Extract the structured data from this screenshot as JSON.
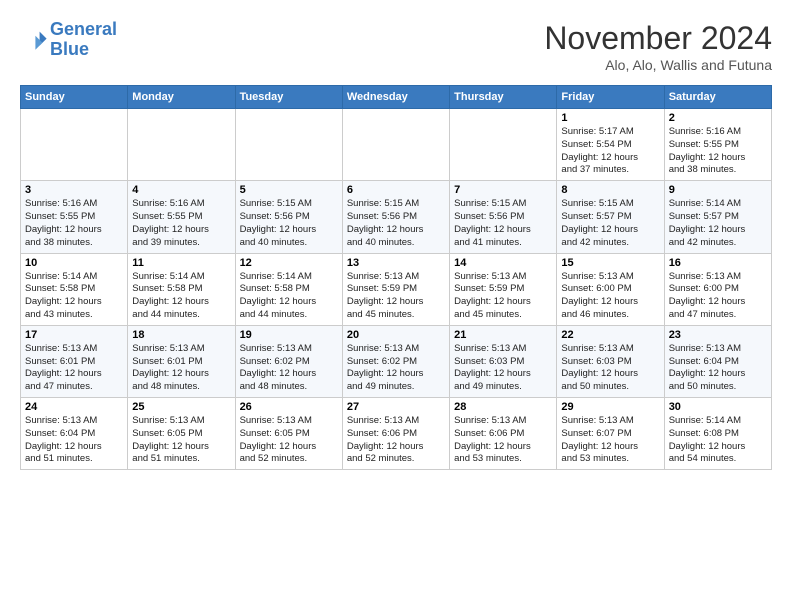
{
  "header": {
    "logo_line1": "General",
    "logo_line2": "Blue",
    "month": "November 2024",
    "location": "Alo, Alo, Wallis and Futuna"
  },
  "weekdays": [
    "Sunday",
    "Monday",
    "Tuesday",
    "Wednesday",
    "Thursday",
    "Friday",
    "Saturday"
  ],
  "weeks": [
    [
      {
        "day": "",
        "info": ""
      },
      {
        "day": "",
        "info": ""
      },
      {
        "day": "",
        "info": ""
      },
      {
        "day": "",
        "info": ""
      },
      {
        "day": "",
        "info": ""
      },
      {
        "day": "1",
        "info": "Sunrise: 5:17 AM\nSunset: 5:54 PM\nDaylight: 12 hours\nand 37 minutes."
      },
      {
        "day": "2",
        "info": "Sunrise: 5:16 AM\nSunset: 5:55 PM\nDaylight: 12 hours\nand 38 minutes."
      }
    ],
    [
      {
        "day": "3",
        "info": "Sunrise: 5:16 AM\nSunset: 5:55 PM\nDaylight: 12 hours\nand 38 minutes."
      },
      {
        "day": "4",
        "info": "Sunrise: 5:16 AM\nSunset: 5:55 PM\nDaylight: 12 hours\nand 39 minutes."
      },
      {
        "day": "5",
        "info": "Sunrise: 5:15 AM\nSunset: 5:56 PM\nDaylight: 12 hours\nand 40 minutes."
      },
      {
        "day": "6",
        "info": "Sunrise: 5:15 AM\nSunset: 5:56 PM\nDaylight: 12 hours\nand 40 minutes."
      },
      {
        "day": "7",
        "info": "Sunrise: 5:15 AM\nSunset: 5:56 PM\nDaylight: 12 hours\nand 41 minutes."
      },
      {
        "day": "8",
        "info": "Sunrise: 5:15 AM\nSunset: 5:57 PM\nDaylight: 12 hours\nand 42 minutes."
      },
      {
        "day": "9",
        "info": "Sunrise: 5:14 AM\nSunset: 5:57 PM\nDaylight: 12 hours\nand 42 minutes."
      }
    ],
    [
      {
        "day": "10",
        "info": "Sunrise: 5:14 AM\nSunset: 5:58 PM\nDaylight: 12 hours\nand 43 minutes."
      },
      {
        "day": "11",
        "info": "Sunrise: 5:14 AM\nSunset: 5:58 PM\nDaylight: 12 hours\nand 44 minutes."
      },
      {
        "day": "12",
        "info": "Sunrise: 5:14 AM\nSunset: 5:58 PM\nDaylight: 12 hours\nand 44 minutes."
      },
      {
        "day": "13",
        "info": "Sunrise: 5:13 AM\nSunset: 5:59 PM\nDaylight: 12 hours\nand 45 minutes."
      },
      {
        "day": "14",
        "info": "Sunrise: 5:13 AM\nSunset: 5:59 PM\nDaylight: 12 hours\nand 45 minutes."
      },
      {
        "day": "15",
        "info": "Sunrise: 5:13 AM\nSunset: 6:00 PM\nDaylight: 12 hours\nand 46 minutes."
      },
      {
        "day": "16",
        "info": "Sunrise: 5:13 AM\nSunset: 6:00 PM\nDaylight: 12 hours\nand 47 minutes."
      }
    ],
    [
      {
        "day": "17",
        "info": "Sunrise: 5:13 AM\nSunset: 6:01 PM\nDaylight: 12 hours\nand 47 minutes."
      },
      {
        "day": "18",
        "info": "Sunrise: 5:13 AM\nSunset: 6:01 PM\nDaylight: 12 hours\nand 48 minutes."
      },
      {
        "day": "19",
        "info": "Sunrise: 5:13 AM\nSunset: 6:02 PM\nDaylight: 12 hours\nand 48 minutes."
      },
      {
        "day": "20",
        "info": "Sunrise: 5:13 AM\nSunset: 6:02 PM\nDaylight: 12 hours\nand 49 minutes."
      },
      {
        "day": "21",
        "info": "Sunrise: 5:13 AM\nSunset: 6:03 PM\nDaylight: 12 hours\nand 49 minutes."
      },
      {
        "day": "22",
        "info": "Sunrise: 5:13 AM\nSunset: 6:03 PM\nDaylight: 12 hours\nand 50 minutes."
      },
      {
        "day": "23",
        "info": "Sunrise: 5:13 AM\nSunset: 6:04 PM\nDaylight: 12 hours\nand 50 minutes."
      }
    ],
    [
      {
        "day": "24",
        "info": "Sunrise: 5:13 AM\nSunset: 6:04 PM\nDaylight: 12 hours\nand 51 minutes."
      },
      {
        "day": "25",
        "info": "Sunrise: 5:13 AM\nSunset: 6:05 PM\nDaylight: 12 hours\nand 51 minutes."
      },
      {
        "day": "26",
        "info": "Sunrise: 5:13 AM\nSunset: 6:05 PM\nDaylight: 12 hours\nand 52 minutes."
      },
      {
        "day": "27",
        "info": "Sunrise: 5:13 AM\nSunset: 6:06 PM\nDaylight: 12 hours\nand 52 minutes."
      },
      {
        "day": "28",
        "info": "Sunrise: 5:13 AM\nSunset: 6:06 PM\nDaylight: 12 hours\nand 53 minutes."
      },
      {
        "day": "29",
        "info": "Sunrise: 5:13 AM\nSunset: 6:07 PM\nDaylight: 12 hours\nand 53 minutes."
      },
      {
        "day": "30",
        "info": "Sunrise: 5:14 AM\nSunset: 6:08 PM\nDaylight: 12 hours\nand 54 minutes."
      }
    ]
  ]
}
